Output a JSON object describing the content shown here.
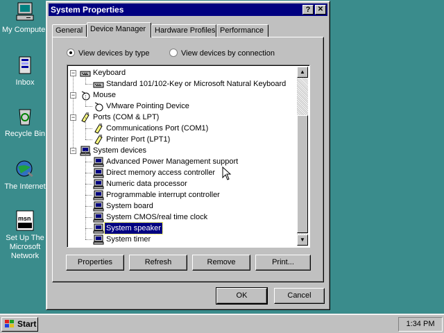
{
  "desktop": {
    "icons": [
      {
        "label": "My Computer",
        "icon": "my-computer-icon"
      },
      {
        "label": "Inbox",
        "icon": "inbox-icon"
      },
      {
        "label": "Recycle Bin",
        "icon": "recycle-bin-icon"
      },
      {
        "label": "The Internet",
        "icon": "internet-icon"
      },
      {
        "label": "Set Up The Microsoft Network",
        "icon": "msn-icon"
      }
    ]
  },
  "dialog": {
    "title": "System Properties",
    "help_label": "?",
    "close_label": "✕",
    "tabs": [
      {
        "label": "General",
        "active": false
      },
      {
        "label": "Device Manager",
        "active": true
      },
      {
        "label": "Hardware Profiles",
        "active": false
      },
      {
        "label": "Performance",
        "active": false
      }
    ],
    "view_options": {
      "by_type": "View devices by type",
      "by_connection": "View devices by connection",
      "selected": "by_type"
    },
    "tree": [
      {
        "label": "Keyboard",
        "level": 0,
        "expanded": true,
        "icon": "keyboard-icon"
      },
      {
        "label": "Standard 101/102-Key or Microsoft Natural Keyboard",
        "level": 1,
        "icon": "keyboard-icon"
      },
      {
        "label": "Mouse",
        "level": 0,
        "expanded": true,
        "icon": "mouse-icon"
      },
      {
        "label": "VMware Pointing Device",
        "level": 1,
        "icon": "mouse-icon"
      },
      {
        "label": "Ports (COM & LPT)",
        "level": 0,
        "expanded": true,
        "icon": "port-icon"
      },
      {
        "label": "Communications Port (COM1)",
        "level": 1,
        "icon": "port-icon"
      },
      {
        "label": "Printer Port (LPT1)",
        "level": 1,
        "icon": "port-icon"
      },
      {
        "label": "System devices",
        "level": 0,
        "expanded": true,
        "icon": "computer-icon"
      },
      {
        "label": "Advanced Power Management support",
        "level": 1,
        "icon": "computer-icon"
      },
      {
        "label": "Direct memory access controller",
        "level": 1,
        "icon": "computer-icon"
      },
      {
        "label": "Numeric data processor",
        "level": 1,
        "icon": "computer-icon"
      },
      {
        "label": "Programmable interrupt controller",
        "level": 1,
        "icon": "computer-icon"
      },
      {
        "label": "System board",
        "level": 1,
        "icon": "computer-icon"
      },
      {
        "label": "System CMOS/real time clock",
        "level": 1,
        "icon": "computer-icon"
      },
      {
        "label": "System speaker",
        "level": 1,
        "icon": "computer-icon",
        "selected": true
      },
      {
        "label": "System timer",
        "level": 1,
        "icon": "computer-icon"
      }
    ],
    "buttons": {
      "properties": "Properties",
      "refresh": "Refresh",
      "remove": "Remove",
      "print": "Print..."
    },
    "ok_label": "OK",
    "cancel_label": "Cancel"
  },
  "taskbar": {
    "start_label": "Start",
    "clock": "1:34 PM"
  },
  "colors": {
    "desktop": "#3a8c8c",
    "title_bar": "#000080",
    "selection": "#000080",
    "face": "#c0c0c0"
  }
}
